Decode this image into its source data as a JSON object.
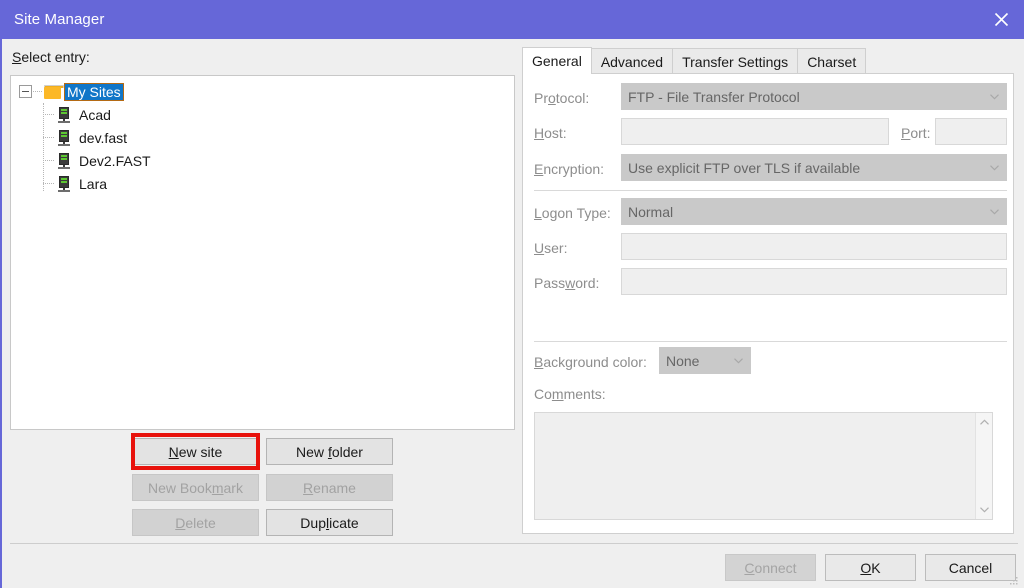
{
  "window": {
    "title": "Site Manager",
    "titlebar_color": "#6667d8",
    "close_icon": "close-icon"
  },
  "left": {
    "select_entry_label": "Select entry:",
    "select_entry_accel": "S",
    "tree": {
      "root": {
        "label": "My Sites",
        "icon": "folder-icon",
        "selected": true,
        "expanded": true
      },
      "children": [
        {
          "label": "Acad",
          "icon": "server-icon"
        },
        {
          "label": "dev.fast",
          "icon": "server-icon"
        },
        {
          "label": "Dev2.FAST",
          "icon": "server-icon"
        },
        {
          "label": "Lara",
          "icon": "server-icon"
        }
      ]
    },
    "buttons": [
      {
        "label": "New site",
        "accel": "N",
        "enabled": true,
        "highlighted": true
      },
      {
        "label": "New folder",
        "accel": "f",
        "enabled": true,
        "highlighted": false
      },
      {
        "label": "New Bookmark",
        "accel": "m",
        "enabled": false,
        "highlighted": false
      },
      {
        "label": "Rename",
        "accel": "R",
        "enabled": false,
        "highlighted": false
      },
      {
        "label": "Delete",
        "accel": "D",
        "enabled": false,
        "highlighted": false
      },
      {
        "label": "Duplicate",
        "accel": "l",
        "enabled": true,
        "highlighted": false
      }
    ],
    "highlight_color": "#e8120c"
  },
  "right": {
    "tabs": [
      {
        "label": "General",
        "active": true
      },
      {
        "label": "Advanced",
        "active": false
      },
      {
        "label": "Transfer Settings",
        "active": false
      },
      {
        "label": "Charset",
        "active": false
      }
    ],
    "fields": {
      "protocol": {
        "label": "Protocol:",
        "accel": "o",
        "value": "FTP - File Transfer Protocol",
        "type": "combo",
        "enabled": false
      },
      "host": {
        "label": "Host:",
        "accel": "H",
        "value": "",
        "type": "text",
        "enabled": false
      },
      "port": {
        "label": "Port:",
        "accel": "P",
        "value": "",
        "type": "text",
        "enabled": false
      },
      "encryption": {
        "label": "Encryption:",
        "accel": "E",
        "value": "Use explicit FTP over TLS if available",
        "type": "combo",
        "enabled": false
      },
      "logon_type": {
        "label": "Logon Type:",
        "accel": "L",
        "value": "Normal",
        "type": "combo",
        "enabled": false
      },
      "user": {
        "label": "User:",
        "accel": "U",
        "value": "",
        "type": "text",
        "enabled": false
      },
      "password": {
        "label": "Password:",
        "accel": "w",
        "value": "",
        "type": "text",
        "enabled": false
      },
      "background_color": {
        "label": "Background color:",
        "accel": "B",
        "value": "None",
        "type": "combo",
        "enabled": false
      },
      "comments": {
        "label": "Comments:",
        "accel": "m",
        "value": "",
        "type": "textarea",
        "enabled": false
      }
    }
  },
  "footer": {
    "buttons": [
      {
        "label": "Connect",
        "accel": "C",
        "enabled": false
      },
      {
        "label": "OK",
        "accel": "O",
        "enabled": true
      },
      {
        "label": "Cancel",
        "accel": "",
        "enabled": true
      }
    ]
  }
}
